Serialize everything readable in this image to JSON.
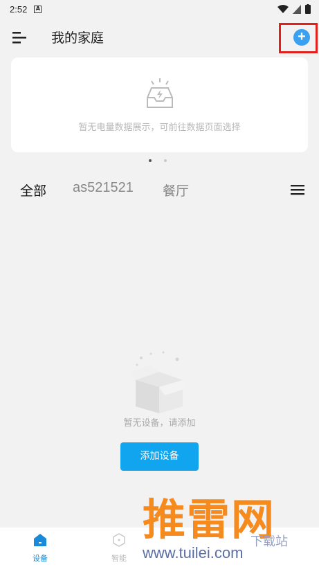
{
  "status_bar": {
    "time": "2:52",
    "notification_icon": "A"
  },
  "header": {
    "title": "我的家庭",
    "add_icon": "+"
  },
  "energy_card": {
    "empty_text": "暂无电量数据展示，可前往数据页面选择"
  },
  "tabs": [
    {
      "label": "全部",
      "active": true
    },
    {
      "label": "as521521",
      "active": false
    },
    {
      "label": "餐厅",
      "active": false
    }
  ],
  "empty_state": {
    "text": "暂无设备，请添加",
    "button_label": "添加设备"
  },
  "bottom_nav": [
    {
      "label": "设备",
      "icon": "home-icon",
      "active": true
    },
    {
      "label": "智能",
      "icon": "smart-icon",
      "active": false
    }
  ],
  "watermark": {
    "brand": "推雷网",
    "url": "www.tuilei.com",
    "small": "下载站"
  },
  "colors": {
    "accent": "#11a5ef",
    "add_button": "#3aa0f0",
    "highlight": "#e0201a",
    "watermark_orange": "#f58a1f"
  }
}
